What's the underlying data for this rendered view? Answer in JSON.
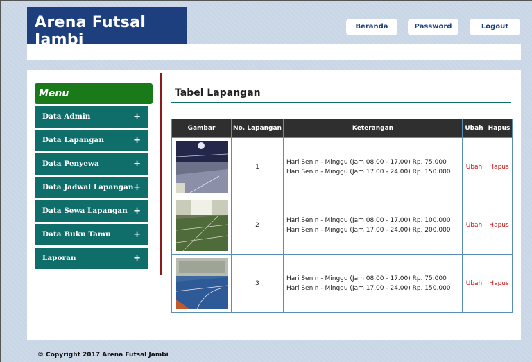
{
  "header": {
    "site_title": "Arena Futsal Jambi",
    "buttons": [
      "Beranda",
      "Password",
      "Logout"
    ]
  },
  "sidebar": {
    "title": "Menu",
    "items": [
      {
        "label": "Data Admin",
        "icon": "+"
      },
      {
        "label": "Data Lapangan",
        "icon": "+"
      },
      {
        "label": "Data Penyewa",
        "icon": "+"
      },
      {
        "label": "Data Jadwal Lapangan",
        "icon": "+"
      },
      {
        "label": "Data Sewa Lapangan",
        "icon": "+"
      },
      {
        "label": "Data Buku Tamu",
        "icon": "+"
      },
      {
        "label": "Laporan",
        "icon": "+"
      }
    ]
  },
  "main": {
    "title": "Tabel Lapangan",
    "table": {
      "headers": [
        "Gambar",
        "No. Lapangan",
        "Keterangan",
        "Ubah",
        "Hapus"
      ],
      "rows": [
        {
          "no": "1",
          "ket1": "Hari Senin - Minggu (Jam 08.00 - 17.00) Rp. 75.000",
          "ket2": "Hari Senin - Minggu (Jam 17.00 - 24.00) Rp. 150.000",
          "ubah": "Ubah",
          "hapus": "Hapus"
        },
        {
          "no": "2",
          "ket1": "Hari Senin - Minggu (Jam 08.00 - 17.00) Rp. 100.000",
          "ket2": "Hari Senin - Minggu (Jam 17.00 - 24.00) Rp. 200.000",
          "ubah": "Ubah",
          "hapus": "Hapus"
        },
        {
          "no": "3",
          "ket1": "Hari Senin - Minggu (Jam 08.00 - 17.00) Rp. 75.000",
          "ket2": "Hari Senin - Minggu (Jam 17.00 - 24.00) Rp. 150.000",
          "ubah": "Ubah",
          "hapus": "Hapus"
        }
      ]
    }
  },
  "footer": {
    "copyright": "© Copyright 2017 Arena Futsal Jambi"
  },
  "colors": {
    "brand_blue": "#1e3f7e",
    "menu_green": "#1a7a1a",
    "menu_teal": "#0f6d6a",
    "accent_red": "#cc1111",
    "divider_red": "#8b1a1a"
  }
}
